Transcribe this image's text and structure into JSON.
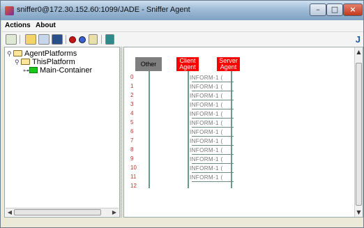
{
  "window": {
    "title": "sniffer0@172.30.152.60:1099/JADE - Sniffer Agent",
    "controls": {
      "minimize": "–",
      "maximize": "□",
      "close": "×"
    }
  },
  "menu": {
    "items": [
      "Actions",
      "About"
    ]
  },
  "toolbar": {
    "icons": [
      "clear-canvas-icon",
      "open-file-icon",
      "display-file-icon",
      "save-icon",
      "add-agent-icon",
      "remove-agent-icon",
      "filter-icon",
      "exit-icon"
    ],
    "logo_text": "J"
  },
  "tree": {
    "root": {
      "label": "AgentPlatforms"
    },
    "platform": {
      "label": "ThisPlatform"
    },
    "container": {
      "label": "Main-Container"
    }
  },
  "sniffer": {
    "agents": [
      {
        "label": "Other"
      },
      {
        "label": "Client Agent"
      },
      {
        "label": "Server Agent"
      }
    ],
    "row_numbers": [
      "0",
      "1",
      "2",
      "3",
      "4",
      "5",
      "6",
      "7",
      "8",
      "9",
      "10",
      "11",
      "12"
    ],
    "messages": [
      {
        "label": "INFORM-1 ("
      },
      {
        "label": "INFORM-1 ("
      },
      {
        "label": "INFORM-1 ("
      },
      {
        "label": "INFORM-1 ("
      },
      {
        "label": "INFORM-1 ("
      },
      {
        "label": "INFORM-1 ("
      },
      {
        "label": "INFORM-1 ("
      },
      {
        "label": "INFORM-1 ("
      },
      {
        "label": "INFORM-1 ("
      },
      {
        "label": "INFORM-1 ("
      },
      {
        "label": "INFORM-1 ("
      },
      {
        "label": "INFORM-1 ("
      }
    ]
  },
  "colors": {
    "agent_red": "#ff0000",
    "agent_other": "#7f7f7f",
    "row_number": "#c0302a",
    "lifeline": "#6b9a8a"
  }
}
